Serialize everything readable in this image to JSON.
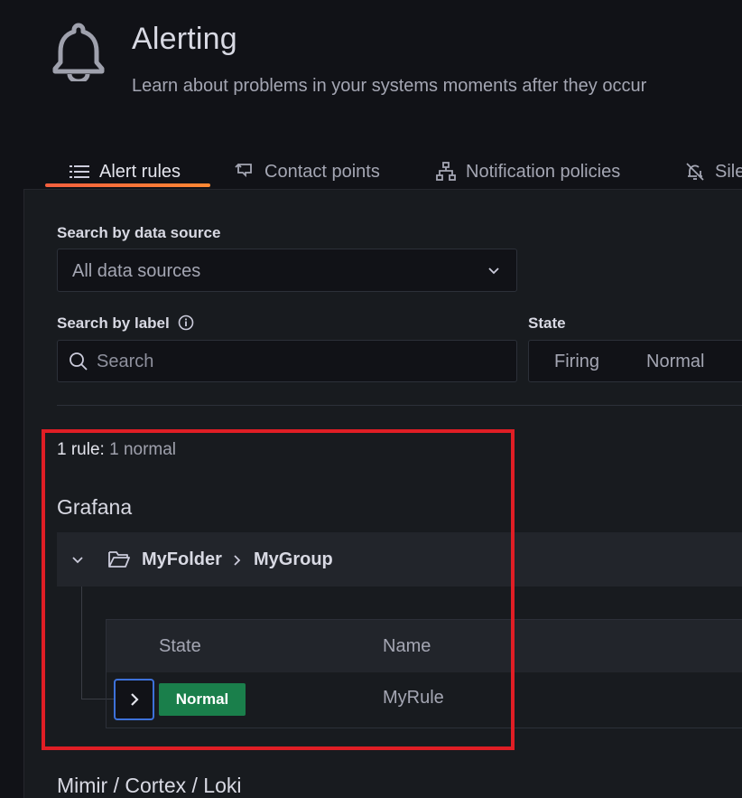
{
  "header": {
    "title": "Alerting",
    "subtitle": "Learn about problems in your systems moments after they occur"
  },
  "tabs": [
    {
      "label": "Alert rules",
      "icon": "list-icon",
      "active": true
    },
    {
      "label": "Contact points",
      "icon": "comment-alt-share-icon",
      "active": false
    },
    {
      "label": "Notification policies",
      "icon": "sitemap-icon",
      "active": false
    },
    {
      "label": "Sile",
      "icon": "bell-slash-icon",
      "active": false
    }
  ],
  "filters": {
    "datasource_label": "Search by data source",
    "datasource_value": "All data sources",
    "label_label": "Search by label",
    "search_placeholder": "Search",
    "state_label": "State",
    "state_options": [
      "Firing",
      "Normal"
    ]
  },
  "summary": {
    "count": "1 rule:",
    "detail": "1 normal"
  },
  "namespaces": {
    "grafana": "Grafana",
    "mimir": "Mimir / Cortex / Loki"
  },
  "group": {
    "folder": "MyFolder",
    "name": "MyGroup"
  },
  "rules_table": {
    "headers": [
      "State",
      "Name"
    ],
    "rows": [
      {
        "state": "Normal",
        "name": "MyRule"
      }
    ]
  },
  "colors": {
    "accent_gradient_start": "#f55f3e",
    "accent_gradient_end": "#ff8833",
    "normal_badge": "#1a7f4b",
    "highlight_box": "#e01e25",
    "focus_ring": "#3d71d9"
  }
}
